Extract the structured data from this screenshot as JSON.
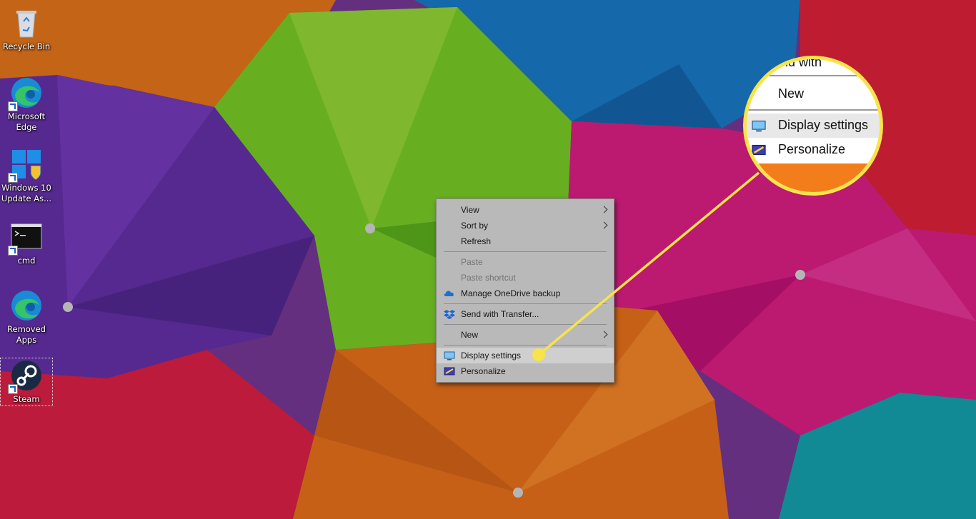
{
  "desktop": {
    "icons": [
      {
        "label": "Recycle Bin",
        "icon": "recycle-bin-icon"
      },
      {
        "label": "Microsoft Edge",
        "icon": "edge-icon"
      },
      {
        "label": "Windows 10 Update As...",
        "icon": "windows-logo-icon"
      },
      {
        "label": "cmd",
        "icon": "terminal-icon"
      },
      {
        "label": "Removed Apps",
        "icon": "edge-icon"
      },
      {
        "label": "Steam",
        "icon": "steam-icon"
      }
    ]
  },
  "context_menu": {
    "items": [
      {
        "label": "View",
        "has_submenu": true,
        "enabled": true
      },
      {
        "label": "Sort by",
        "has_submenu": true,
        "enabled": true
      },
      {
        "label": "Refresh",
        "has_submenu": false,
        "enabled": true
      },
      {
        "label": "Paste",
        "has_submenu": false,
        "enabled": false
      },
      {
        "label": "Paste shortcut",
        "has_submenu": false,
        "enabled": false
      },
      {
        "label": "Manage OneDrive backup",
        "icon": "onedrive-cloud-icon",
        "enabled": true
      },
      {
        "label": "Send with Transfer...",
        "icon": "dropbox-icon",
        "enabled": true
      },
      {
        "label": "New",
        "has_submenu": true,
        "enabled": true
      },
      {
        "label": "Display settings",
        "icon": "monitor-icon",
        "enabled": true,
        "highlighted": true
      },
      {
        "label": "Personalize",
        "icon": "personalize-icon",
        "enabled": true
      }
    ]
  },
  "zoom_callout": {
    "partial_label": "nd with",
    "items": [
      "New",
      "Display settings",
      "Personalize"
    ],
    "accent_color": "#f8e44a"
  }
}
